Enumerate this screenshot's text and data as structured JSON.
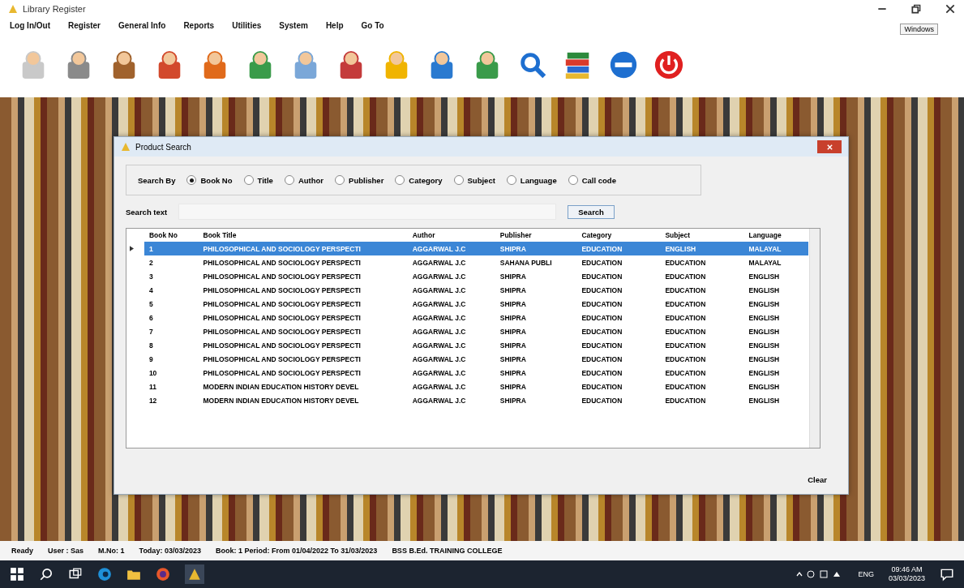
{
  "window": {
    "title": "Library Register",
    "button": "Windows"
  },
  "menu": [
    "Log In/Out",
    "Register",
    "General Info",
    "Reports",
    "Utilities",
    "System",
    "Help",
    "Go To"
  ],
  "dialog": {
    "title": "Product Search",
    "search_by_label": "Search By",
    "options": [
      {
        "label": "Book No",
        "selected": true
      },
      {
        "label": "Title",
        "selected": false
      },
      {
        "label": "Author",
        "selected": false
      },
      {
        "label": "Publisher",
        "selected": false
      },
      {
        "label": "Category",
        "selected": false
      },
      {
        "label": "Subject",
        "selected": false
      },
      {
        "label": "Language",
        "selected": false
      },
      {
        "label": "Call code",
        "selected": false
      }
    ],
    "search_text_label": "Search text",
    "search_button": "Search",
    "clear_button": "Clear"
  },
  "table": {
    "columns": [
      "Book No",
      "Book Title",
      "Author",
      "Publisher",
      "Category",
      "Subject",
      "Language"
    ],
    "rows": [
      {
        "selected": true,
        "cells": [
          "1",
          "PHILOSOPHICAL AND SOCIOLOGY PERSPECTI",
          "AGGARWAL J.C",
          "SHIPRA",
          "EDUCATION",
          "ENGLISH",
          "MALAYAL"
        ]
      },
      {
        "selected": false,
        "cells": [
          "2",
          "PHILOSOPHICAL AND SOCIOLOGY PERSPECTI",
          "AGGARWAL J.C",
          "SAHANA PUBLI",
          "EDUCATION",
          "EDUCATION",
          "MALAYAL"
        ]
      },
      {
        "selected": false,
        "cells": [
          "3",
          "PHILOSOPHICAL AND SOCIOLOGY PERSPECTI",
          "AGGARWAL J.C",
          "SHIPRA",
          "EDUCATION",
          "EDUCATION",
          "ENGLISH"
        ]
      },
      {
        "selected": false,
        "cells": [
          "4",
          "PHILOSOPHICAL AND SOCIOLOGY PERSPECTI",
          "AGGARWAL J.C",
          "SHIPRA",
          "EDUCATION",
          "EDUCATION",
          "ENGLISH"
        ]
      },
      {
        "selected": false,
        "cells": [
          "5",
          "PHILOSOPHICAL AND SOCIOLOGY PERSPECTI",
          "AGGARWAL J.C",
          "SHIPRA",
          "EDUCATION",
          "EDUCATION",
          "ENGLISH"
        ]
      },
      {
        "selected": false,
        "cells": [
          "6",
          "PHILOSOPHICAL AND SOCIOLOGY PERSPECTI",
          "AGGARWAL J.C",
          "SHIPRA",
          "EDUCATION",
          "EDUCATION",
          "ENGLISH"
        ]
      },
      {
        "selected": false,
        "cells": [
          "7",
          "PHILOSOPHICAL AND SOCIOLOGY PERSPECTI",
          "AGGARWAL J.C",
          "SHIPRA",
          "EDUCATION",
          "EDUCATION",
          "ENGLISH"
        ]
      },
      {
        "selected": false,
        "cells": [
          "8",
          "PHILOSOPHICAL AND SOCIOLOGY PERSPECTI",
          "AGGARWAL J.C",
          "SHIPRA",
          "EDUCATION",
          "EDUCATION",
          "ENGLISH"
        ]
      },
      {
        "selected": false,
        "cells": [
          "9",
          "PHILOSOPHICAL AND SOCIOLOGY PERSPECTI",
          "AGGARWAL J.C",
          "SHIPRA",
          "EDUCATION",
          "EDUCATION",
          "ENGLISH"
        ]
      },
      {
        "selected": false,
        "cells": [
          "10",
          "PHILOSOPHICAL AND SOCIOLOGY PERSPECTI",
          "AGGARWAL J.C",
          "SHIPRA",
          "EDUCATION",
          "EDUCATION",
          "ENGLISH"
        ]
      },
      {
        "selected": false,
        "cells": [
          "11",
          "MODERN INDIAN EDUCATION HISTORY DEVEL",
          "AGGARWAL J.C",
          "SHIPRA",
          "EDUCATION",
          "EDUCATION",
          "ENGLISH"
        ]
      },
      {
        "selected": false,
        "cells": [
          "12",
          "MODERN INDIAN EDUCATION HISTORY DEVEL",
          "AGGARWAL J.C",
          "SHIPRA",
          "EDUCATION",
          "EDUCATION",
          "ENGLISH"
        ]
      }
    ]
  },
  "status_bar": [
    "Ready",
    "User : Sas",
    "M.No: 1",
    "Today: 03/03/2023",
    "Book: 1 Period: From 01/04/2022 To 31/03/2023",
    "BSS B.Ed. TRAINING COLLEGE"
  ],
  "taskbar": {
    "tray_language": "ENG",
    "time": "09:46 AM",
    "date": "03/03/2023"
  }
}
